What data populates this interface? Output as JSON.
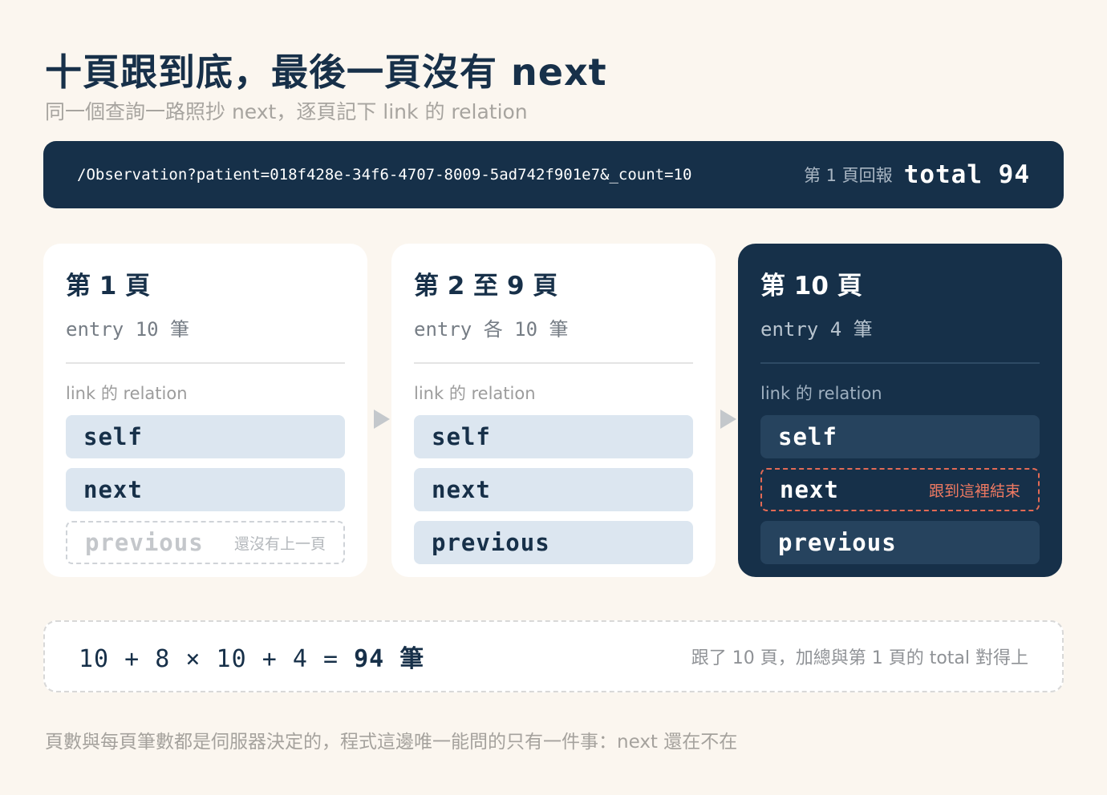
{
  "title": "十頁跟到底，最後一頁沒有 next",
  "subtitle": "同一個查詢一路照抄 next，逐頁記下 link 的 relation",
  "query": {
    "url": "/Observation?patient=018f428e-34f6-4707-8009-5ad742f901e7&_count=10",
    "first_page_label": "第 1 頁回報",
    "total_text": "total 94"
  },
  "cards": [
    {
      "title": "第 1 頁",
      "entry": "entry 10 筆",
      "relation_label": "link 的 relation",
      "relations": [
        {
          "name": "self",
          "note": ""
        },
        {
          "name": "next",
          "note": ""
        },
        {
          "name": "previous",
          "note": "還沒有上一頁"
        }
      ]
    },
    {
      "title": "第 2 至 9 頁",
      "entry": "entry 各 10 筆",
      "relation_label": "link 的 relation",
      "relations": [
        {
          "name": "self",
          "note": ""
        },
        {
          "name": "next",
          "note": ""
        },
        {
          "name": "previous",
          "note": ""
        }
      ]
    },
    {
      "title": "第 10 頁",
      "entry": "entry 4 筆",
      "relation_label": "link 的 relation",
      "relations": [
        {
          "name": "self",
          "note": ""
        },
        {
          "name": "next",
          "note": "跟到這裡結束"
        },
        {
          "name": "previous",
          "note": ""
        }
      ]
    }
  ],
  "summary": {
    "equation": "10 + 8 × 10 + 4 = ",
    "result": "94 筆",
    "note": "跟了 10 頁，加總與第 1 頁的 total 對得上"
  },
  "footer": "頁數與每頁筆數都是伺服器決定的，程式這邊唯一能問的只有一件事：next 還在不在",
  "colors": {
    "navy": "#163049",
    "relation_fill": "#dce6f0",
    "end_accent": "#e26a55",
    "background": "#fbf6ef"
  }
}
